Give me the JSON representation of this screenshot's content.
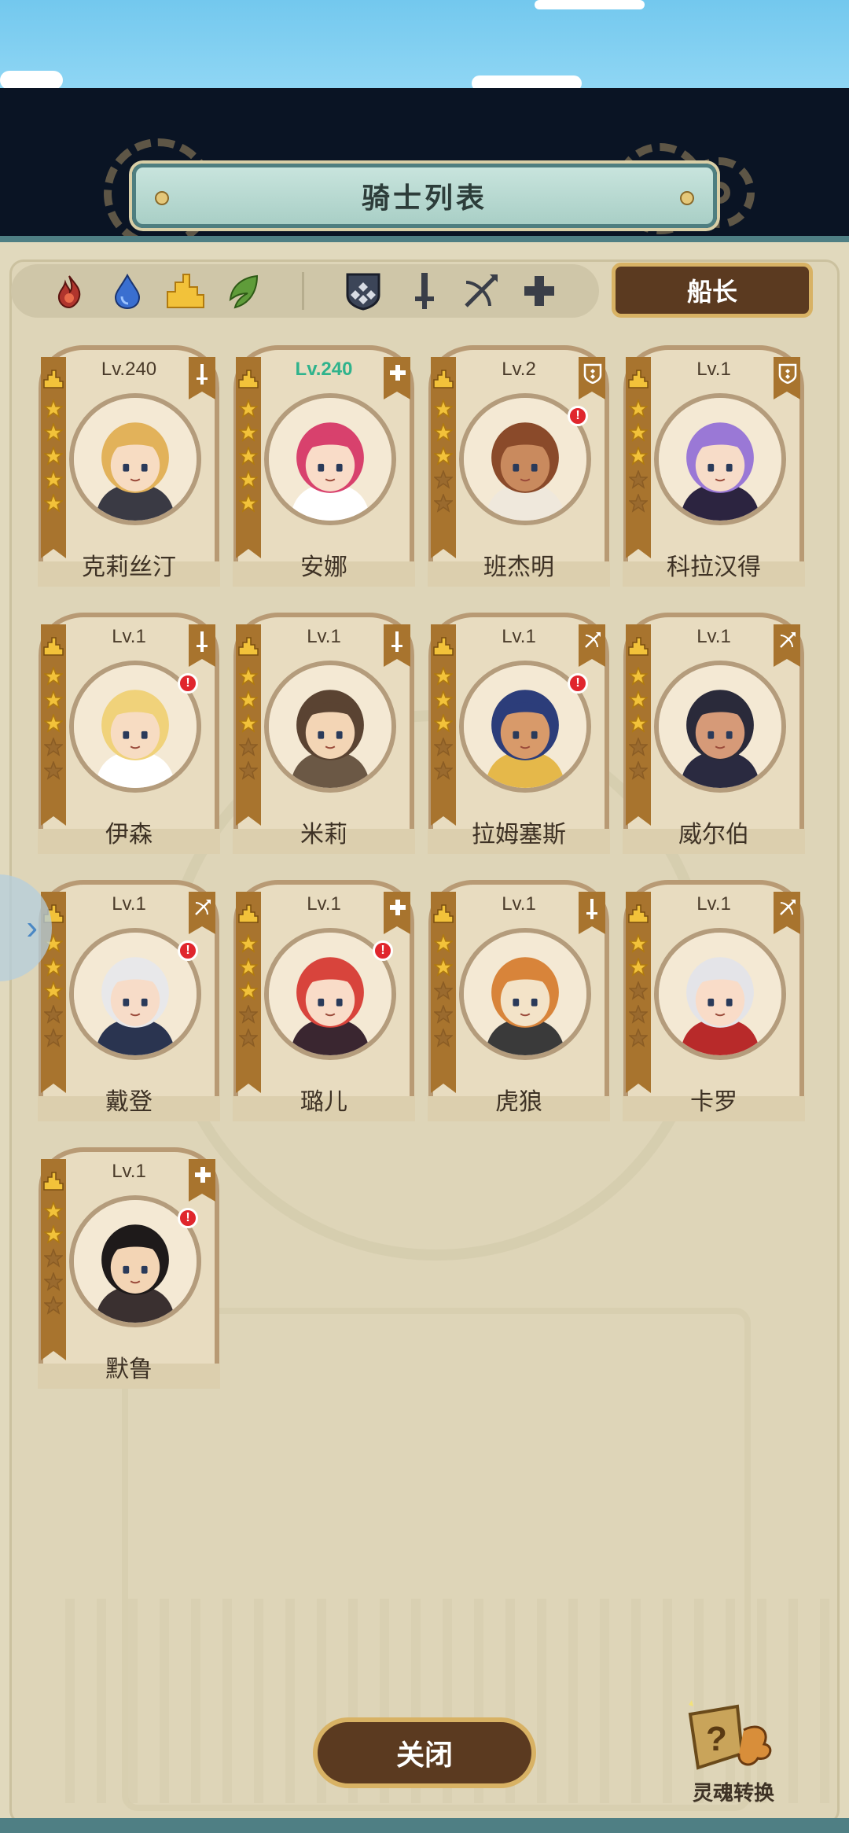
{
  "window": {
    "title": "骑士列表"
  },
  "filters": {
    "elements": [
      "fire-element-icon",
      "water-element-icon",
      "earth-element-icon",
      "wind-element-icon"
    ],
    "classes": [
      "shield-class-icon",
      "sword-class-icon",
      "bow-class-icon",
      "healer-class-icon"
    ]
  },
  "captain_button": "船长",
  "knights": [
    {
      "name": "克莉丝汀",
      "level": "Lv.240",
      "stars": 5,
      "class_icon": "sword-class-icon",
      "alert": false,
      "highlight": false,
      "hair": "#e2b25a",
      "skin": "#f7dcc2",
      "outfit": "#3a3a44"
    },
    {
      "name": "安娜",
      "level": "Lv.240",
      "stars": 5,
      "class_icon": "healer-class-icon",
      "alert": false,
      "highlight": true,
      "hair": "#d8416d",
      "skin": "#f9dcc8",
      "outfit": "#ffffff"
    },
    {
      "name": "班杰明",
      "level": "Lv.2",
      "stars": 3,
      "class_icon": "shield-class-icon",
      "alert": true,
      "highlight": false,
      "hair": "#8a4a2a",
      "skin": "#c98a5e",
      "outfit": "#efe8dc"
    },
    {
      "name": "科拉汉得",
      "level": "Lv.1",
      "stars": 3,
      "class_icon": "shield-class-icon",
      "alert": false,
      "highlight": false,
      "hair": "#9a78d6",
      "skin": "#f7dcc8",
      "outfit": "#2c2440"
    },
    {
      "name": "伊森",
      "level": "Lv.1",
      "stars": 3,
      "class_icon": "sword-class-icon",
      "alert": true,
      "highlight": false,
      "hair": "#f0d27a",
      "skin": "#f7dcc2",
      "outfit": "#ffffff"
    },
    {
      "name": "米莉",
      "level": "Lv.1",
      "stars": 3,
      "class_icon": "sword-class-icon",
      "alert": false,
      "highlight": false,
      "hair": "#5a4332",
      "skin": "#f3d5b5",
      "outfit": "#6b5845"
    },
    {
      "name": "拉姆塞斯",
      "level": "Lv.1",
      "stars": 3,
      "class_icon": "bow-class-icon",
      "alert": true,
      "highlight": false,
      "hair": "#2c3d7a",
      "skin": "#d89a6a",
      "outfit": "#e5b84a"
    },
    {
      "name": "威尔伯",
      "level": "Lv.1",
      "stars": 3,
      "class_icon": "bow-class-icon",
      "alert": false,
      "highlight": false,
      "hair": "#2a2a3a",
      "skin": "#d69a78",
      "outfit": "#2a2a40"
    },
    {
      "name": "戴登",
      "level": "Lv.1",
      "stars": 3,
      "class_icon": "bow-class-icon",
      "alert": true,
      "highlight": false,
      "hair": "#e8e8ea",
      "skin": "#f7dcc8",
      "outfit": "#2a3450"
    },
    {
      "name": "璐儿",
      "level": "Lv.1",
      "stars": 3,
      "class_icon": "healer-class-icon",
      "alert": true,
      "highlight": false,
      "hair": "#d8443c",
      "skin": "#f9dcc8",
      "outfit": "#3a2630"
    },
    {
      "name": "虎狼",
      "level": "Lv.1",
      "stars": 2,
      "class_icon": "sword-class-icon",
      "alert": false,
      "highlight": false,
      "hair": "#d8843a",
      "skin": "#f3e3c8",
      "outfit": "#3a3a3a"
    },
    {
      "name": "卡罗",
      "level": "Lv.1",
      "stars": 2,
      "class_icon": "bow-class-icon",
      "alert": false,
      "highlight": false,
      "hair": "#e4e4e8",
      "skin": "#f9dcc8",
      "outfit": "#b82a2a"
    },
    {
      "name": "默鲁",
      "level": "Lv.1",
      "stars": 2,
      "class_icon": "healer-class-icon",
      "alert": true,
      "highlight": false,
      "hair": "#1e1a1a",
      "skin": "#f3d5b5",
      "outfit": "#3a3030"
    }
  ],
  "close_button": "关闭",
  "soul_convert": {
    "label": "灵魂转换",
    "icon": "soul-convert-icon"
  },
  "colors": {
    "accent": "#d8b264",
    "panel": "#ded5b8",
    "frame": "#4f7f84",
    "star": "#f2c23a"
  }
}
